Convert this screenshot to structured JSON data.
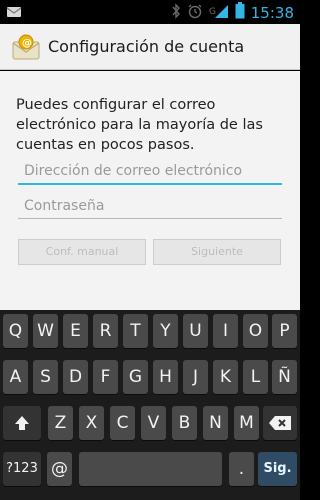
{
  "status_bar": {
    "time": "15:38",
    "icons": [
      "notification-envelope-icon",
      "bluetooth-icon",
      "alarm-icon",
      "signal-g-icon",
      "battery-icon"
    ],
    "accent": "#33b5e5"
  },
  "action_bar": {
    "title": "Configuración de cuenta",
    "app_icon": "email-app-icon"
  },
  "main": {
    "intro": "Puedes configurar el correo electrónico para la mayoría de las cuentas en pocos pasos.",
    "email_placeholder": "Dirección de correo electrónico",
    "email_value": "",
    "password_placeholder": "Contraseña",
    "password_value": "",
    "buttons": {
      "manual": "Conf. manual",
      "next": "Siguiente"
    }
  },
  "keyboard": {
    "row1": [
      "Q",
      "W",
      "E",
      "R",
      "T",
      "Y",
      "U",
      "I",
      "O",
      "P"
    ],
    "row2": [
      "A",
      "S",
      "D",
      "F",
      "G",
      "H",
      "J",
      "K",
      "L",
      "Ñ"
    ],
    "row3": [
      "Z",
      "X",
      "C",
      "V",
      "B",
      "N",
      "M"
    ],
    "row4": {
      "symbols": "?123",
      "at": "@",
      "period": ".",
      "send": "Sig."
    },
    "icons": [
      "shift-icon",
      "backspace-icon"
    ]
  }
}
